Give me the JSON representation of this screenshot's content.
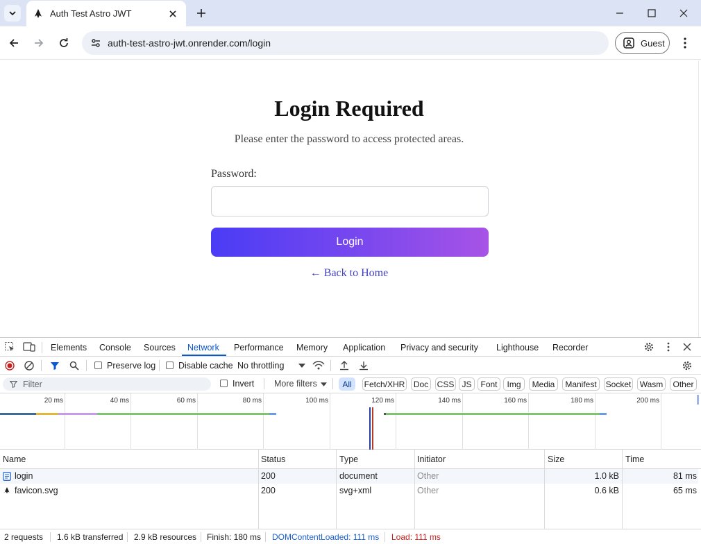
{
  "browser": {
    "tab_title": "Auth Test Astro JWT",
    "url": "auth-test-astro-jwt.onrender.com/login",
    "profile_label": "Guest"
  },
  "page": {
    "title": "Login Required",
    "subtitle": "Please enter the password to access protected areas.",
    "password_label": "Password:",
    "password_value": "",
    "login_button": "Login",
    "back_link": "← Back to Home"
  },
  "colors": {
    "button_gradient_start": "#4a3cf5",
    "button_gradient_end": "#a753e6",
    "link": "#3f3fc4",
    "devtools_accent": "#0b57d0"
  },
  "devtools": {
    "tabs": [
      "Elements",
      "Console",
      "Sources",
      "Network",
      "Performance",
      "Memory",
      "Application",
      "Privacy and security",
      "Lighthouse",
      "Recorder"
    ],
    "active_tab": "Network",
    "toolbar": {
      "preserve_log": "Preserve log",
      "disable_cache": "Disable cache",
      "throttling": "No throttling"
    },
    "filter": {
      "placeholder": "Filter",
      "invert": "Invert",
      "more_filters": "More filters",
      "types": [
        "All",
        "Fetch/XHR",
        "Doc",
        "CSS",
        "JS",
        "Font",
        "Img",
        "Media",
        "Manifest",
        "Socket",
        "Wasm",
        "Other"
      ],
      "active_type": "All"
    },
    "timeline_ticks": [
      "20 ms",
      "40 ms",
      "60 ms",
      "80 ms",
      "100 ms",
      "120 ms",
      "140 ms",
      "160 ms",
      "180 ms",
      "200 ms"
    ],
    "columns": [
      "Name",
      "Status",
      "Type",
      "Initiator",
      "Size",
      "Time"
    ],
    "requests": [
      {
        "name": "login",
        "status": "200",
        "type": "document",
        "initiator": "Other",
        "size": "1.0 kB",
        "time": "81 ms",
        "icon": "document-icon"
      },
      {
        "name": "favicon.svg",
        "status": "200",
        "type": "svg+xml",
        "initiator": "Other",
        "size": "0.6 kB",
        "time": "65 ms",
        "icon": "svg-file-icon"
      }
    ],
    "status": {
      "requests": "2 requests",
      "transferred": "1.6 kB transferred",
      "resources": "2.9 kB resources",
      "finish": "Finish: 180 ms",
      "dom_loaded": "DOMContentLoaded: 111 ms",
      "load": "Load: 111 ms"
    }
  }
}
